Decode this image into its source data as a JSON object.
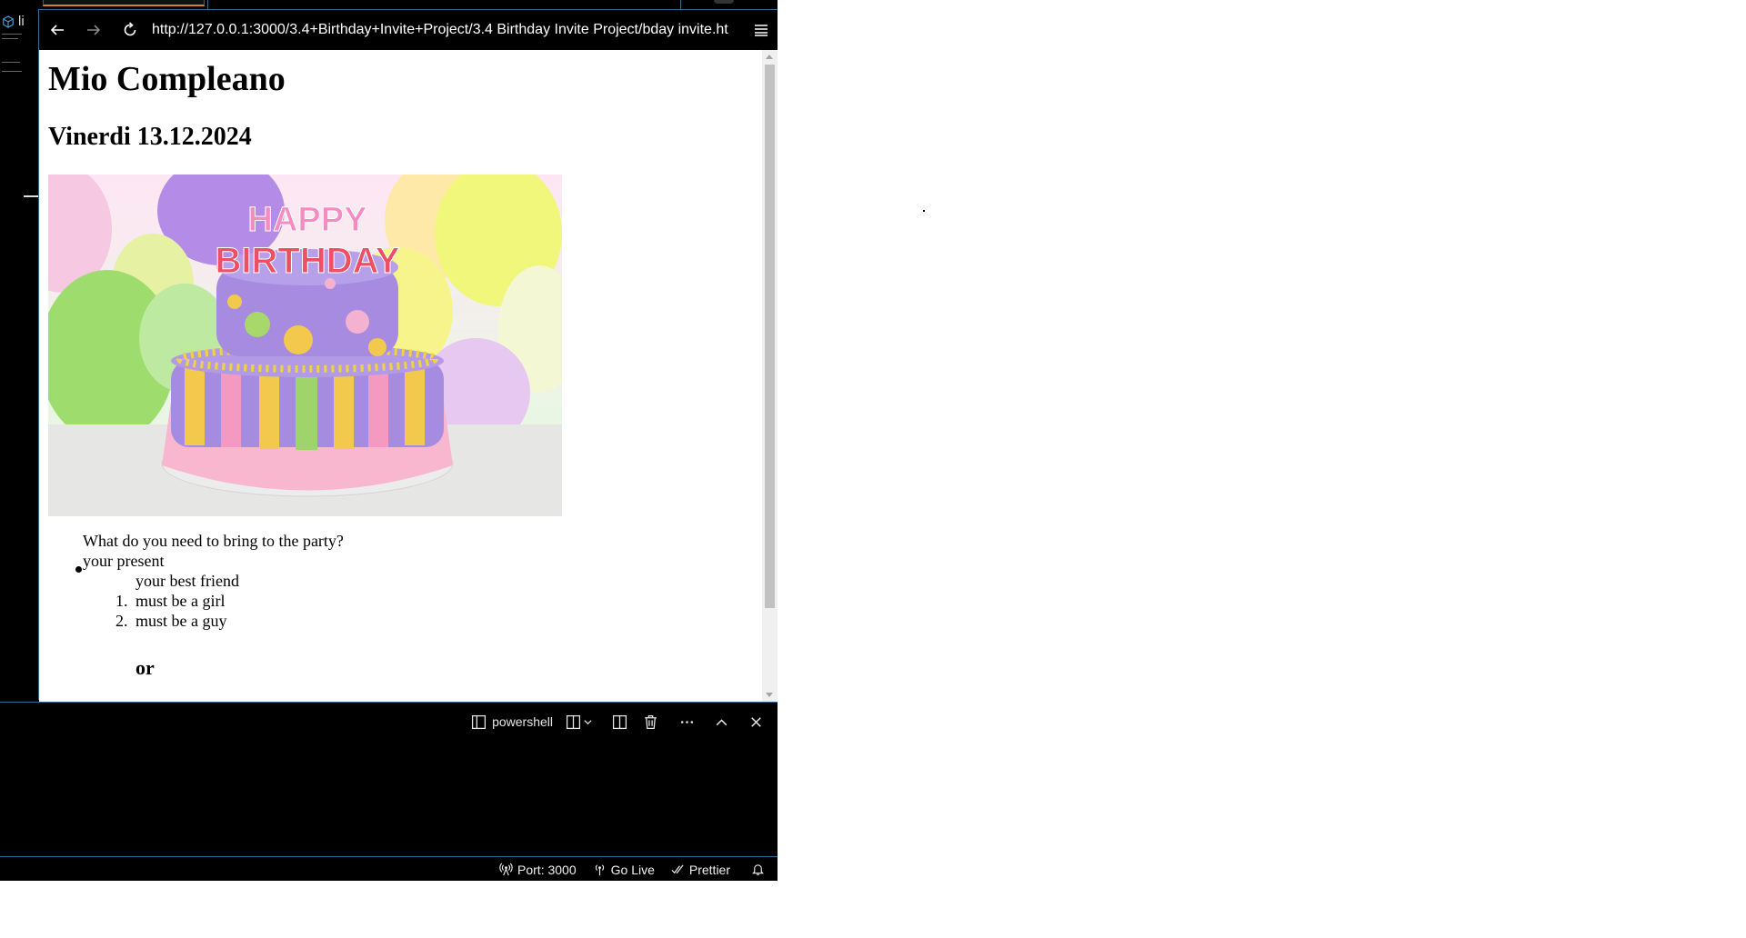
{
  "sidebar": {
    "label": "li"
  },
  "browser": {
    "url": "http://127.0.0.1:3000/3.4+Birthday+Invite+Project/3.4 Birthday Invite Project/bday invite.ht"
  },
  "page": {
    "title": "Mio Compleano",
    "date": "Vinerdi 13.12.2024",
    "cake_text_1": "HAPPY",
    "cake_text_2": "BIRTHDAY",
    "question": "What do you need to bring to the party?",
    "item_present": "your present",
    "item_friend": "your best friend",
    "ordered": [
      {
        "num": "1.",
        "text": "must be a girl"
      },
      {
        "num": "2.",
        "text": "must be a guy"
      }
    ],
    "or": "or"
  },
  "panel": {
    "terminal_label": "powershell"
  },
  "status": {
    "port": "Port: 3000",
    "golive": "Go Live",
    "prettier": "Prettier"
  },
  "icons": [
    "back-icon",
    "forward-icon",
    "reload-icon",
    "menu-icon",
    "terminal-icon",
    "split-icon",
    "chevron-down-icon",
    "trash-icon",
    "ellipsis-icon",
    "chevron-up-icon",
    "close-icon",
    "broadcast-icon",
    "antenna-icon",
    "check-all-icon",
    "bell-icon",
    "cube-icon"
  ],
  "colors": {
    "accent_border": "#2b6f91",
    "active_tab_underline": "#d9822b"
  }
}
